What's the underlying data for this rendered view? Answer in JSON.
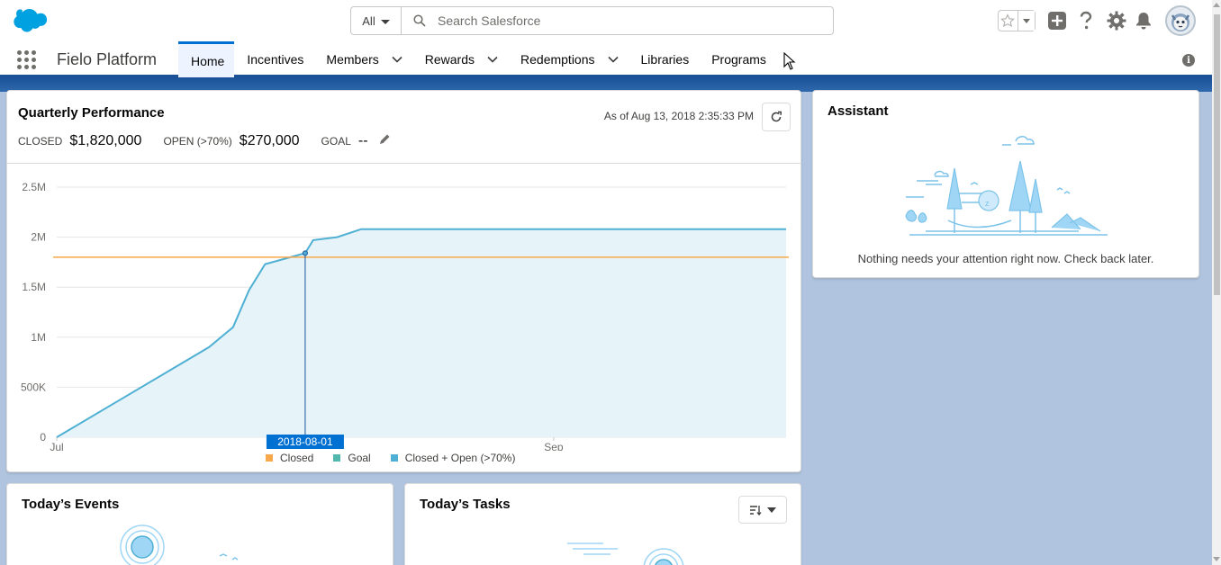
{
  "header": {
    "search_scope": "All",
    "search_placeholder": "Search Salesforce"
  },
  "nav": {
    "app_name": "Fielo Platform",
    "tabs": [
      {
        "label": "Home",
        "active": true,
        "has_menu": false
      },
      {
        "label": "Incentives",
        "has_menu": false
      },
      {
        "label": "Members",
        "has_menu": true
      },
      {
        "label": "Rewards",
        "has_menu": true
      },
      {
        "label": "Redemptions",
        "has_menu": true
      },
      {
        "label": "Libraries",
        "has_menu": false
      },
      {
        "label": "Programs",
        "has_menu": false
      }
    ]
  },
  "quarterly": {
    "title": "Quarterly Performance",
    "as_of": "As of Aug 13, 2018 2:35:33 PM",
    "closed_label": "CLOSED",
    "closed_value": "$1,820,000",
    "open_label": "OPEN (>70%)",
    "open_value": "$270,000",
    "goal_label": "GOAL",
    "goal_value": "--",
    "tooltip_date": "2018-08-01"
  },
  "chart_data": {
    "type": "area",
    "y_ticks": [
      "0",
      "500K",
      "1M",
      "1.5M",
      "2M",
      "2.5M"
    ],
    "x_ticks": [
      "Jul",
      "Sep"
    ],
    "ylim": [
      0,
      2500000
    ],
    "legend": [
      "Closed",
      "Goal",
      "Closed + Open (>70%)"
    ],
    "colors": {
      "closed": "#f7a84a",
      "goal": "#52b7ac",
      "closed_open": "#4fb0d4",
      "area": "#e6f4f9",
      "goal_line": "#f7a84a"
    },
    "goal_value": 1800000,
    "series": [
      {
        "name": "Closed + Open (>70%)",
        "points": [
          {
            "x": "2018-07-01",
            "y": 0
          },
          {
            "x": "2018-07-20",
            "y": 900000
          },
          {
            "x": "2018-07-23",
            "y": 1100000
          },
          {
            "x": "2018-07-25",
            "y": 1470000
          },
          {
            "x": "2018-07-27",
            "y": 1730000
          },
          {
            "x": "2018-08-01",
            "y": 1840000
          },
          {
            "x": "2018-08-02",
            "y": 1970000
          },
          {
            "x": "2018-08-05",
            "y": 2000000
          },
          {
            "x": "2018-08-08",
            "y": 2080000
          },
          {
            "x": "2018-09-30",
            "y": 2080000
          }
        ]
      }
    ]
  },
  "assistant": {
    "title": "Assistant",
    "message": "Nothing needs your attention right now. Check back later."
  },
  "events": {
    "title": "Today’s Events"
  },
  "tasks": {
    "title": "Today’s Tasks"
  }
}
